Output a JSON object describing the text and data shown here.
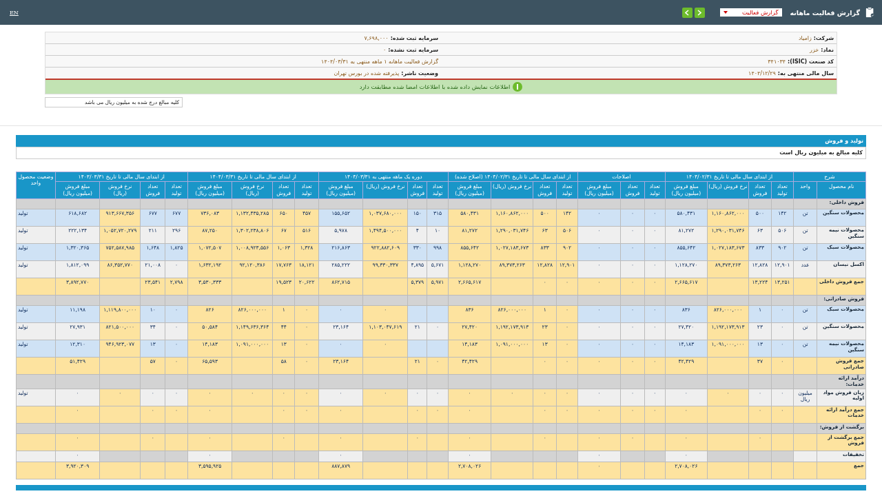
{
  "header": {
    "title": "گزارش فعالیت ماهانه",
    "report_select": "گزارش فعالیت",
    "lang_link": "EN"
  },
  "info_rows": [
    {
      "right": {
        "label": "شرکت:",
        "value": "زامیاد"
      },
      "left": {
        "label": "سرمایه ثبت شده:",
        "value": "۷,۶۹۸,۰۰۰"
      }
    },
    {
      "right": {
        "label": "نماد:",
        "value": "خزر"
      },
      "left": {
        "label": "سرمایه ثبت نشده:",
        "value": "۰"
      }
    },
    {
      "right": {
        "label": "کد صنعت (ISIC):",
        "value": "۳۴۱۰۳۴"
      },
      "left": {
        "value": "گزارش فعالیت ماهانه ۱ ماهه منتهی به ۱۴۰۴/۰۳/۳۱"
      }
    },
    {
      "right": {
        "label": "سال مالی منتهی به:",
        "value": "۱۴۰۴/۱۲/۲۹"
      },
      "left": {
        "label": "وضعیت ناشر:",
        "value": "پذیرفته شده در بورس تهران"
      }
    }
  ],
  "notice": "اطلاعات نمایش داده شده با اطلاعات امضا شده مطابقت دارد",
  "amount_note": "کلیه مبالغ درج شده به میلیون ریال می باشد",
  "section": {
    "title": "تولید و فروش",
    "note": "کلیه مبالغ به میلیون ریال است"
  },
  "table": {
    "groups": [
      {
        "title": "شرح",
        "columns": [
          "نام محصول",
          "واحد"
        ]
      },
      {
        "title": "از ابتدای سال مالی تا تاریخ ۱۴۰۴/۰۲/۳۱",
        "columns": [
          "تعداد تولید",
          "تعداد فروش",
          "نرخ فروش (ریال)",
          "مبلغ فروش (میلیون ریال)"
        ]
      },
      {
        "title": "اصلاحات",
        "columns": [
          "تعداد تولید",
          "تعداد فروش",
          "مبلغ فروش (میلیون ریال)"
        ]
      },
      {
        "title": "از ابتدای سال مالی تا تاریخ ۱۴۰۴/۰۲/۳۱ (اصلاح شده)",
        "columns": [
          "تعداد تولید",
          "تعداد فروش",
          "نرخ فروش (ریال)",
          "مبلغ فروش (میلیون ریال)"
        ]
      },
      {
        "title": "دوره یک ماهه منتهی به ۱۴۰۴/۰۳/۳۱",
        "columns": [
          "تعداد تولید",
          "تعداد فروش",
          "نرخ فروش (ریال)",
          "مبلغ فروش (میلیون ریال)"
        ]
      },
      {
        "title": "از ابتدای سال مالی تا تاریخ ۱۴۰۴/۰۳/۳۱",
        "columns": [
          "تعداد تولید",
          "تعداد فروش",
          "نرخ فروش (ریال)",
          "مبلغ فروش (میلیون ریال)"
        ]
      },
      {
        "title": "از ابتدای سال مالی تا تاریخ ۱۴۰۳/۰۳/۳۱",
        "columns": [
          "تعداد تولید",
          "تعداد فروش",
          "نرخ فروش (ریال)",
          "مبلغ فروش (میلیون ریال)"
        ]
      },
      {
        "title": "وضعیت محصول واحد"
      }
    ],
    "rows": [
      {
        "kind": "section",
        "label": "فروش داخلی:"
      },
      {
        "kind": "product",
        "cells": [
          "محصولات سنگین",
          "تن",
          "۱۴۲",
          "۵۰۰",
          "۱,۱۶۰,۸۶۲,۰۰۰",
          "۵۸۰,۴۳۱",
          "۰",
          "۰",
          "۰",
          "۱۴۲",
          "۵۰۰",
          "۱,۱۶۰,۸۶۲,۰۰۰",
          "۵۸۰,۴۳۱",
          "۳۱۵",
          "۱۵۰",
          "۱,۰۳۷,۶۸۰,۰۰۰",
          "۱۵۵,۶۵۲",
          "۴۵۷",
          "۶۵۰",
          "۱,۱۳۲,۴۳۵,۲۸۵",
          "۷۳۶,۰۸۳",
          "۶۷۷",
          "۶۷۷",
          "۹۱۳,۶۶۷,۳۵۶",
          "۶۱۸,۶۸۲",
          "تولید"
        ]
      },
      {
        "kind": "product",
        "cells": [
          "محصولات نیمه سنگین",
          "تن",
          "۵۰۶",
          "۶۳",
          "۱,۲۹۰,۰۳۱,۷۴۶",
          "۸۱,۲۷۲",
          "۰",
          "۰",
          "۰",
          "۵۰۶",
          "۶۳",
          "۱,۲۹۰,۰۳۱,۷۴۶",
          "۸۱,۲۷۲",
          "۱۰",
          "۴",
          "۱,۴۹۴,۵۰۰,۰۰۰",
          "۵,۹۷۸",
          "۵۱۶",
          "۶۷",
          "۱,۳۰۲,۲۳۸,۸۰۶",
          "۸۷,۲۵۰",
          "۲۹۶",
          "۲۱۱",
          "۱,۰۵۲,۷۲۰,۲۷۹",
          "۲۲۲,۱۳۴",
          "تولید"
        ]
      },
      {
        "kind": "product",
        "cells": [
          "محصولات سبک",
          "تن",
          "۹۰۲",
          "۸۳۳",
          "۱,۰۲۷,۱۸۳,۶۷۳",
          "۸۵۵,۶۴۲",
          "۰",
          "۰",
          "۰",
          "۹۰۲",
          "۸۳۳",
          "۱,۰۲۷,۱۸۳,۶۷۳",
          "۸۵۵,۶۴۲",
          "۹۹۸",
          "۳۳۰",
          "۹۲۲,۸۸۲,۶۰۹",
          "۲۱۶,۸۶۳",
          "۱,۳۲۸",
          "۱,۰۶۳",
          "۱,۰۰۸,۹۲۳,۵۵۶",
          "۱,۰۷۲,۵۰۷",
          "۱,۸۲۵",
          "۱,۶۴۸",
          "۷۵۲,۵۸۷,۹۸۵",
          "۱,۳۲۰,۳۶۵",
          "تولید"
        ]
      },
      {
        "kind": "product",
        "cells": [
          "اکسل نیسان",
          "عدد",
          "۱۲,۹۰۱",
          "۱۲,۸۲۸",
          "۸۹,۳۷۳,۲۶۳",
          "۱,۱۲۸,۲۷۰",
          "۰",
          "۰",
          "۰",
          "۱۲,۹۰۱",
          "۱۲,۸۲۸",
          "۸۹,۳۷۳,۲۶۳",
          "۱,۱۲۸,۲۷۰",
          "۵,۶۷۱",
          "۴,۸۹۵",
          "۹۹,۳۳۰,۳۳۷",
          "۲۸۵,۲۲۲",
          "۱۸,۱۲۱",
          "۱۷,۷۶۳",
          "۹۲,۱۲۰,۳۸۶",
          "۱,۶۳۲,۱۹۲",
          "۰",
          "۲۱,۰۰۸",
          "۸۶,۳۵۲,۷۷۰",
          "۱,۸۱۲,۰۹۹",
          "تولید"
        ]
      },
      {
        "kind": "total",
        "cells": [
          "جمع فروش داخلی",
          "",
          "۱۳,۲۵۱",
          "۱۳,۲۲۴",
          "",
          "۲,۶۶۵,۶۱۷",
          "۰",
          "۰",
          "۰",
          "۰",
          "۰",
          "",
          "۲,۶۶۵,۶۱۷",
          "۵,۹۷۱",
          "۵,۳۷۹",
          "",
          "۸۶۲,۷۱۵",
          "۲۰,۶۲۲",
          "۱۹,۵۲۳",
          "",
          "۳,۵۳۰,۳۳۳",
          "۲,۷۹۸",
          "۲۳,۵۴۱",
          "",
          "۳,۸۹۲,۷۷۰",
          ""
        ]
      },
      {
        "kind": "section",
        "label": "فروش صادراتی:"
      },
      {
        "kind": "product",
        "cells": [
          "محصولات سبک",
          "تن",
          "۰",
          "۱",
          "۸۲۶,۰۰۰,۰۰۰",
          "۸۳۶",
          "۰",
          "۰",
          "۰",
          "۰",
          "۱",
          "۸۲۶,۰۰۰,۰۰۰",
          "۸۳۶",
          "",
          "",
          "۰",
          "۰",
          "۰",
          "۱",
          "۸۲۶,۰۰۰,۰۰۰",
          "۸۲۶",
          "۰",
          "۱۰",
          "۱,۱۱۹,۸۰۰,۰۰۰",
          "۱۱,۱۹۸",
          "تولید"
        ]
      },
      {
        "kind": "product",
        "cells": [
          "محصولات سنگین",
          "تن",
          "۰",
          "۲۳",
          "۱,۱۹۲,۱۷۳,۹۱۳",
          "۲۷,۴۲۰",
          "۰",
          "۰",
          "۰",
          "۰",
          "۲۳",
          "۱,۱۹۲,۱۷۳,۹۱۳",
          "۲۷,۴۲۰",
          "۰",
          "۲۱",
          "۱,۱۰۳,۰۴۷,۶۱۹",
          "۲۳,۱۶۴",
          "۰",
          "۴۴",
          "۱,۱۴۹,۶۳۶,۳۶۴",
          "۵۰,۵۸۴",
          "۰",
          "۳۴",
          "۸۲۱,۵۰۰,۰۰۰",
          "۲۷,۹۳۱",
          "تولید"
        ]
      },
      {
        "kind": "product",
        "cells": [
          "محصولات نیمه سنگین",
          "تن",
          "۰",
          "۱۳",
          "۱,۰۹۱,۰۰۰,۰۰۰",
          "۱۴,۱۸۳",
          "۰",
          "۰",
          "۰",
          "۰",
          "۱۳",
          "۱,۰۹۱,۰۰۰,۰۰۰",
          "۱۴,۱۸۳",
          "",
          "",
          "۰",
          "۰",
          "۰",
          "۱۳",
          "۱,۰۹۱,۰۰۰,۰۰۰",
          "۱۴,۱۸۳",
          "۰",
          "۱۳",
          "۹۴۶,۹۲۳,۰۷۷",
          "۱۲,۳۱۰",
          "تولید"
        ]
      },
      {
        "kind": "total",
        "cells": [
          "جمع فروش صادراتی",
          "",
          "۰",
          "۳۷",
          "",
          "۴۲,۴۲۹",
          "۰",
          "۰",
          "۰",
          "۰",
          "۰",
          "",
          "۴۲,۴۲۹",
          "۰",
          "۲۱",
          "",
          "۲۳,۱۶۴",
          "۰",
          "۵۸",
          "",
          "۶۵,۵۹۳",
          "۰",
          "۵۷",
          "",
          "۵۱,۴۲۹",
          ""
        ]
      },
      {
        "kind": "section",
        "label": "درآمد ارائه خدمات:"
      },
      {
        "kind": "product",
        "cells": [
          "زیان فروش مواد اولیه",
          "میلیون ریال",
          "۰",
          "۰",
          "۰",
          "۰",
          "۰",
          "۰",
          "۰",
          "۰",
          "۰",
          "۰",
          "۰",
          "۰",
          "۰",
          "۰",
          "۰",
          "۰",
          "۰",
          "۰",
          "۰",
          "۰",
          "۰",
          "۰",
          "۰",
          "تولید"
        ]
      },
      {
        "kind": "total",
        "cells": [
          "جمع درآمد ارائه خدمات",
          "",
          "۰",
          "۰",
          "",
          "۰",
          "۰",
          "۰",
          "۰",
          "۰",
          "۰",
          "",
          "۰",
          "۰",
          "۰",
          "",
          "۰",
          "۰",
          "۰",
          "",
          "۰",
          "۰",
          "۰",
          "",
          "۰",
          ""
        ]
      },
      {
        "kind": "section",
        "label": "برگشت از فروش:"
      },
      {
        "kind": "total",
        "cells": [
          "جمع برگشت از فروش",
          "",
          "",
          "۰",
          "",
          "۰",
          "",
          "۰",
          "۰",
          "",
          "۰",
          "",
          "۰",
          "",
          "۰",
          "",
          "۰",
          "",
          "۰",
          "",
          "۰",
          "",
          "۰",
          "",
          "۰",
          ""
        ]
      },
      {
        "kind": "discount",
        "cells": [
          "تخفیفات",
          "",
          "",
          "",
          "",
          "۰",
          "",
          "",
          "۰",
          "",
          "",
          "",
          "۰",
          "",
          "",
          "",
          "۰",
          "",
          "",
          "",
          "۰",
          "",
          "",
          "",
          "۰",
          ""
        ]
      },
      {
        "kind": "total",
        "cells": [
          "جمع",
          "",
          "",
          "",
          "",
          "۲,۷۰۸,۰۲۶",
          "",
          "",
          "۰",
          "",
          "",
          "",
          "۲,۷۰۸,۰۲۶",
          "",
          "",
          "",
          "۸۸۷,۸۷۹",
          "",
          "",
          "",
          "۳,۵۹۵,۹۲۵",
          "",
          "",
          "",
          "۳,۹۲۰,۳۰۹",
          ""
        ]
      }
    ]
  }
}
